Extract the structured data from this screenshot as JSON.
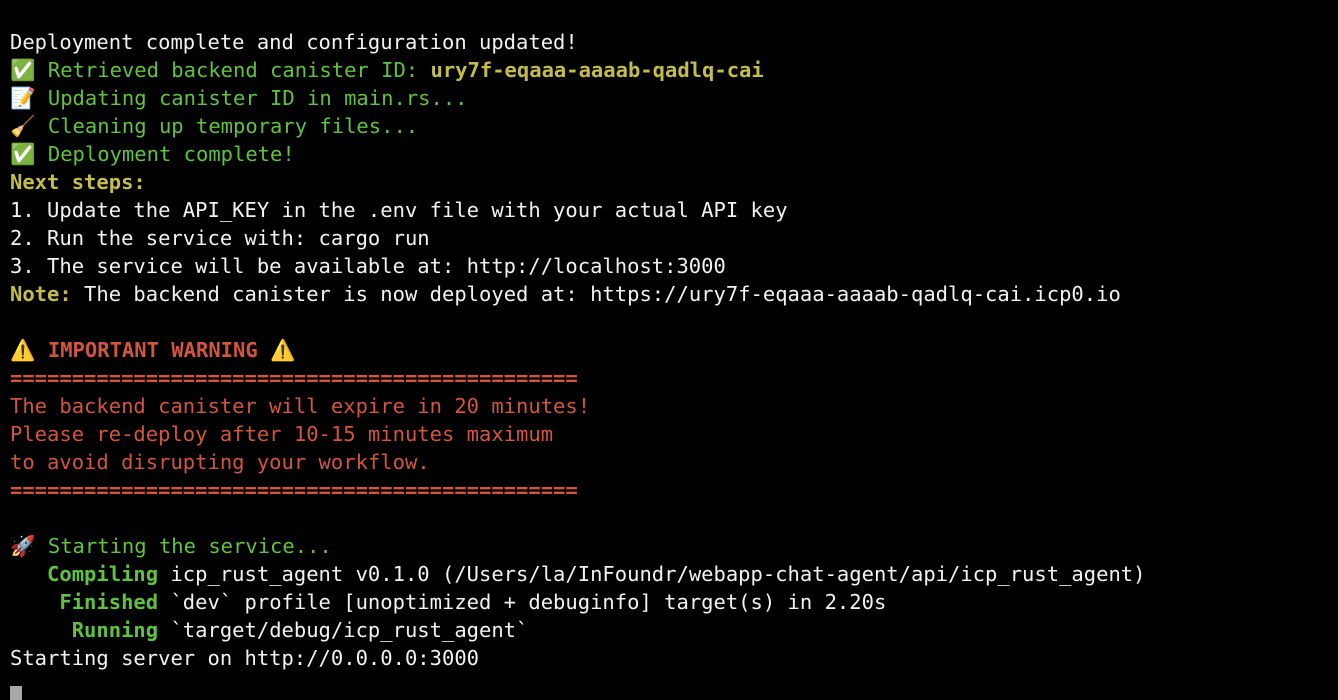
{
  "terminal": {
    "lines": {
      "l1": "Deployment complete and configuration updated!",
      "l2_icon": "✅",
      "l2_text": " Retrieved backend canister ID: ",
      "l2_id": "ury7f-eqaaa-aaaab-qadlq-cai",
      "l3_icon": "📝",
      "l3_text": " Updating canister ID in main.rs...",
      "l4_icon": "🧹",
      "l4_text": " Cleaning up temporary files...",
      "l5_icon": "✅",
      "l5_text": " Deployment complete!",
      "l6": "Next steps:",
      "l7": "1. Update the API_KEY in the .env file with your actual API key",
      "l8": "2. Run the service with: cargo run",
      "l9": "3. The service will be available at: http://localhost:3000",
      "l10_label": "Note:",
      "l10_text": " The backend canister is now deployed at: https://ury7f-eqaaa-aaaab-qadlq-cai.icp0.io",
      "warn_icon_left": "⚠️",
      "warn_title": " IMPORTANT WARNING ",
      "warn_icon_right": "⚠️",
      "sep1": "==============================================",
      "w1": "The backend canister will expire in 20 minutes!",
      "w2": "Please re-deploy after 10-15 minutes maximum",
      "w3": "to avoid disrupting your workflow.",
      "sep2": "==============================================",
      "start_icon": "🚀",
      "start_text": " Starting the service...",
      "c_label": "   Compiling",
      "c_text": " icp_rust_agent v0.1.0 (/Users/la/InFoundr/webapp-chat-agent/api/icp_rust_agent)",
      "f_label": "    Finished",
      "f_text": " `dev` profile [unoptimized + debuginfo] target(s) in 2.20s",
      "r_label": "     Running",
      "r_text": " `target/debug/icp_rust_agent`",
      "server": "Starting server on http://0.0.0.0:3000"
    },
    "colors": {
      "green": "#5fc33f",
      "yellow": "#c4bd4a",
      "red": "#d2553c",
      "text": "#f2f2f2",
      "background": "#000000"
    }
  }
}
